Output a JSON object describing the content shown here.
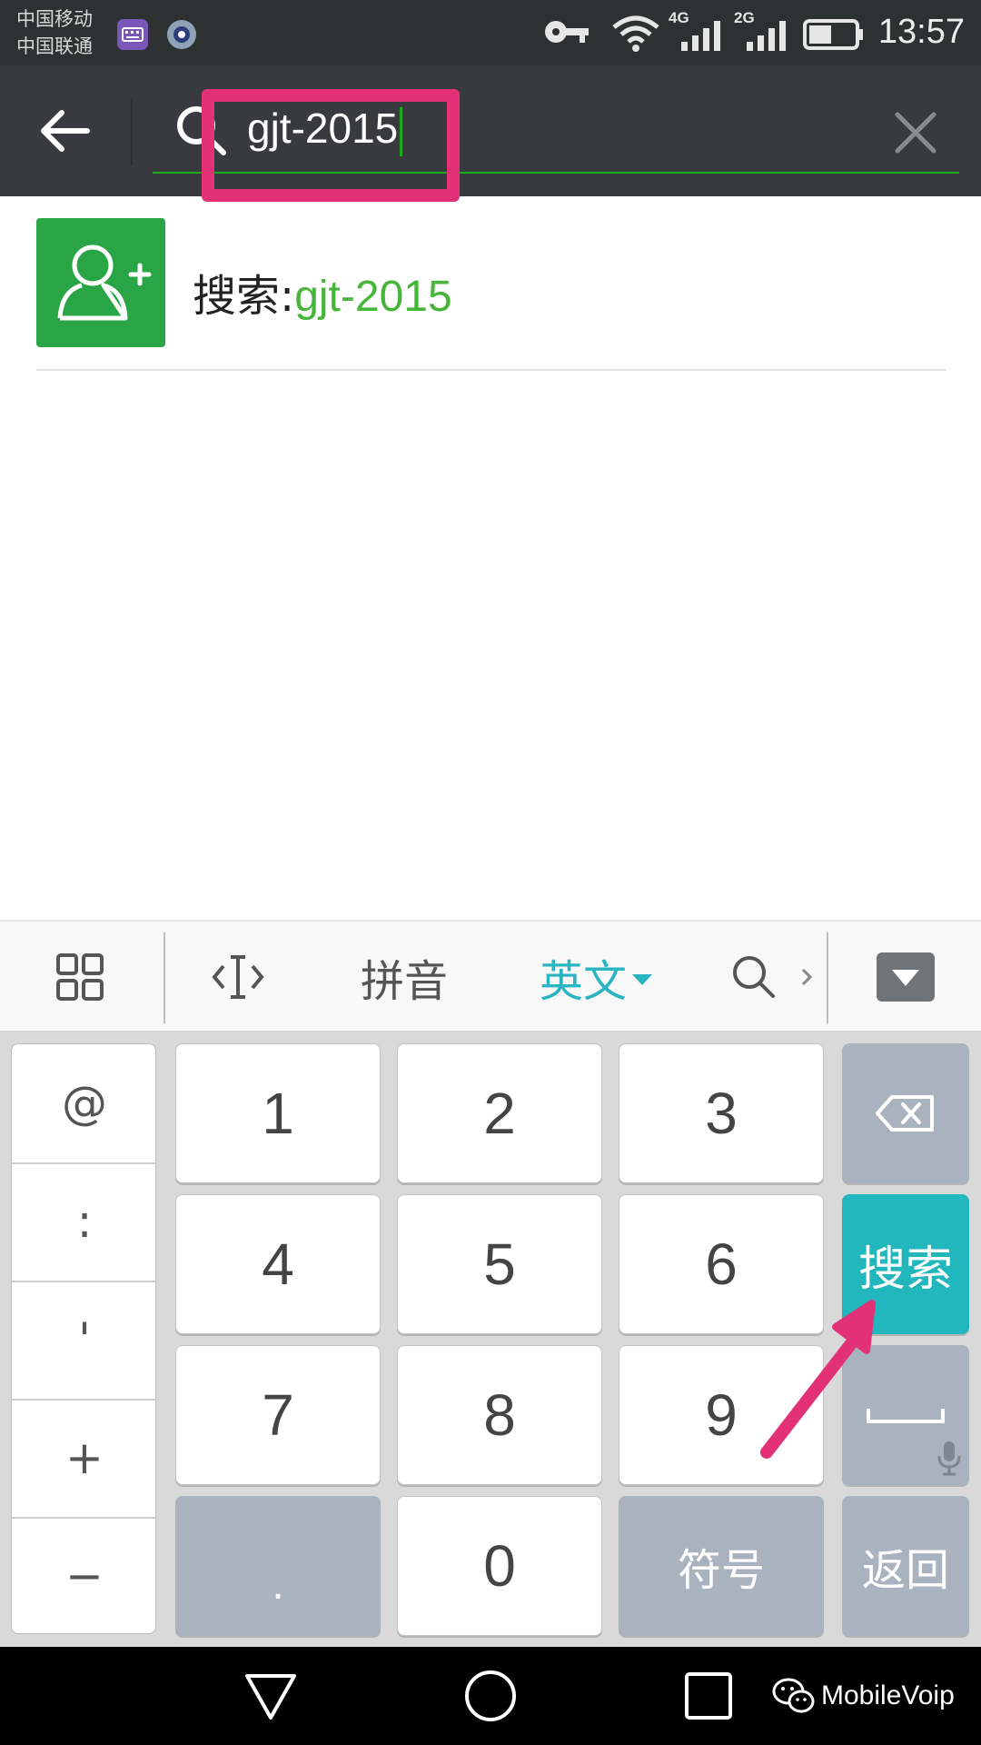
{
  "status_bar": {
    "carrier_1": "中国移动",
    "carrier_2": "中国联通",
    "network_1": "4G",
    "network_2": "2G",
    "time": "13:57",
    "icons": [
      "keyboard-app-icon",
      "browser-app-icon",
      "key-icon",
      "wifi-icon",
      "signal-icon",
      "battery-icon"
    ]
  },
  "search_header": {
    "query": "gjt-2015",
    "icons": [
      "back-arrow-icon",
      "search-icon",
      "close-icon"
    ]
  },
  "result": {
    "prefix": "搜索:",
    "term": "gjt-2015",
    "icon": "add-contact-icon"
  },
  "keyboard_toolbar": {
    "pinyin_label": "拼音",
    "english_label": "英文",
    "icons": [
      "grid-menu-icon",
      "cursor-move-icon",
      "search-icon",
      "chevron-right-icon",
      "hide-keyboard-icon"
    ]
  },
  "keyboard": {
    "symbols": [
      "@",
      ":",
      "'",
      "+",
      "−"
    ],
    "digits": [
      "1",
      "2",
      "3",
      "4",
      "5",
      "6",
      "7",
      "8",
      "9"
    ],
    "dot": ".",
    "zero": "0",
    "symbol_key": "符号",
    "search_key": "搜索",
    "return_key": "返回",
    "icons": [
      "backspace-icon",
      "space-icon",
      "microphone-icon"
    ]
  },
  "nav_bar": {
    "watermark": "MobileVoip",
    "icons": [
      "back-triangle-icon",
      "home-circle-icon",
      "recents-square-icon",
      "wechat-icon"
    ]
  },
  "colors": {
    "header_bg": "#393a3f",
    "accent_green": "#1aad19",
    "result_term": "#46b53a",
    "keyboard_accent": "#22b6bd",
    "highlight": "#e33177"
  }
}
